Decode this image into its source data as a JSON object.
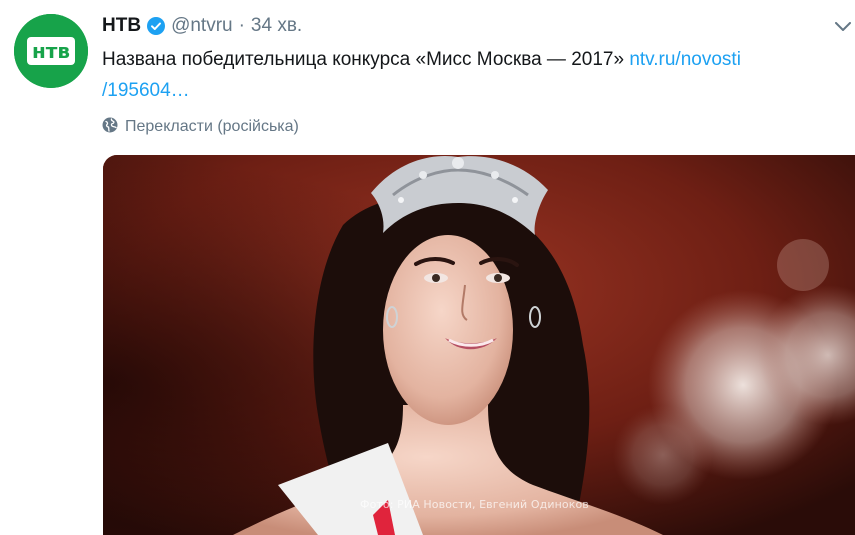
{
  "tweet": {
    "author_name": "НТВ",
    "handle": "@ntvru",
    "separator": "·",
    "time": "34 хв.",
    "text": "Названа победительница конкурса «Мисс Москва — 2017» ",
    "link_line1": "ntv.ru/novosti",
    "link_line2": "/195604…",
    "translate_label": "Перекласти (російська)",
    "photo_credit": "Фото: РИА Новости, Евгений Одиноков",
    "avatar_logo_text": "нтв"
  },
  "icons": {
    "verified": "verified-badge-icon",
    "more": "chevron-down-icon",
    "translate": "globe-icon"
  },
  "colors": {
    "link": "#1da1f2",
    "verified": "#1da1f2",
    "muted": "#657786",
    "avatar_bg": "#17a34a"
  }
}
